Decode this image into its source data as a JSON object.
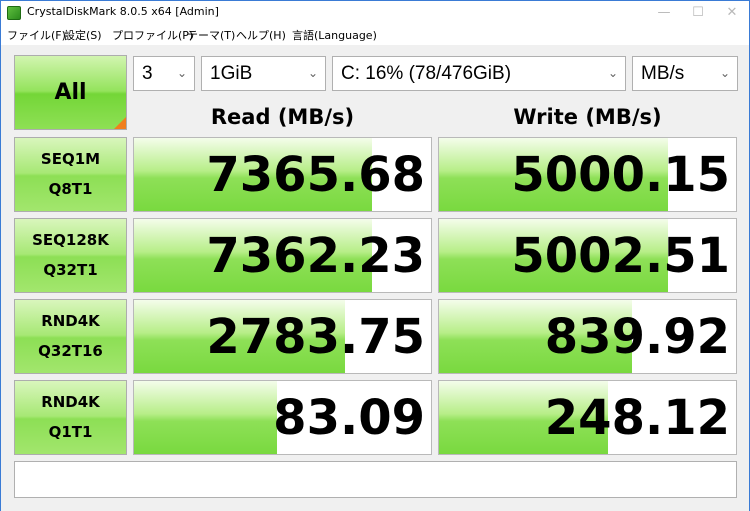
{
  "window": {
    "title": "CrystalDiskMark 8.0.5 x64 [Admin]",
    "controls": {
      "minimize": "—",
      "maximize": "☐",
      "close": "✕"
    }
  },
  "menu": {
    "items": [
      "ファイル(F)",
      "設定(S)",
      "プロファイル(P)",
      "テーマ(T)",
      "ヘルプ(H)",
      "言語(Language)"
    ]
  },
  "toolbar": {
    "all_label": "All",
    "count": "3",
    "size": "1GiB",
    "drive": "C: 16% (78/476GiB)",
    "unit": "MB/s"
  },
  "headers": {
    "read": "Read (MB/s)",
    "write": "Write (MB/s)"
  },
  "tests": [
    {
      "line1": "SEQ1M",
      "line2": "Q8T1",
      "read": "7365.68",
      "write": "5000.15",
      "read_fill": 0.8,
      "write_fill": 0.77
    },
    {
      "line1": "SEQ128K",
      "line2": "Q32T1",
      "read": "7362.23",
      "write": "5002.51",
      "read_fill": 0.8,
      "write_fill": 0.77
    },
    {
      "line1": "RND4K",
      "line2": "Q32T16",
      "read": "2783.75",
      "write": "839.92",
      "read_fill": 0.71,
      "write_fill": 0.65
    },
    {
      "line1": "RND4K",
      "line2": "Q1T1",
      "read": "83.09",
      "write": "248.12",
      "read_fill": 0.48,
      "write_fill": 0.57
    }
  ],
  "comment": "",
  "colors": {
    "accent_green": "#79d93f",
    "corner_orange": "#f07f1e",
    "window_border": "#3a7bd5"
  },
  "icons": {
    "select_arrow": "chevron-down-icon",
    "app": "crystaldiskmark-icon"
  }
}
